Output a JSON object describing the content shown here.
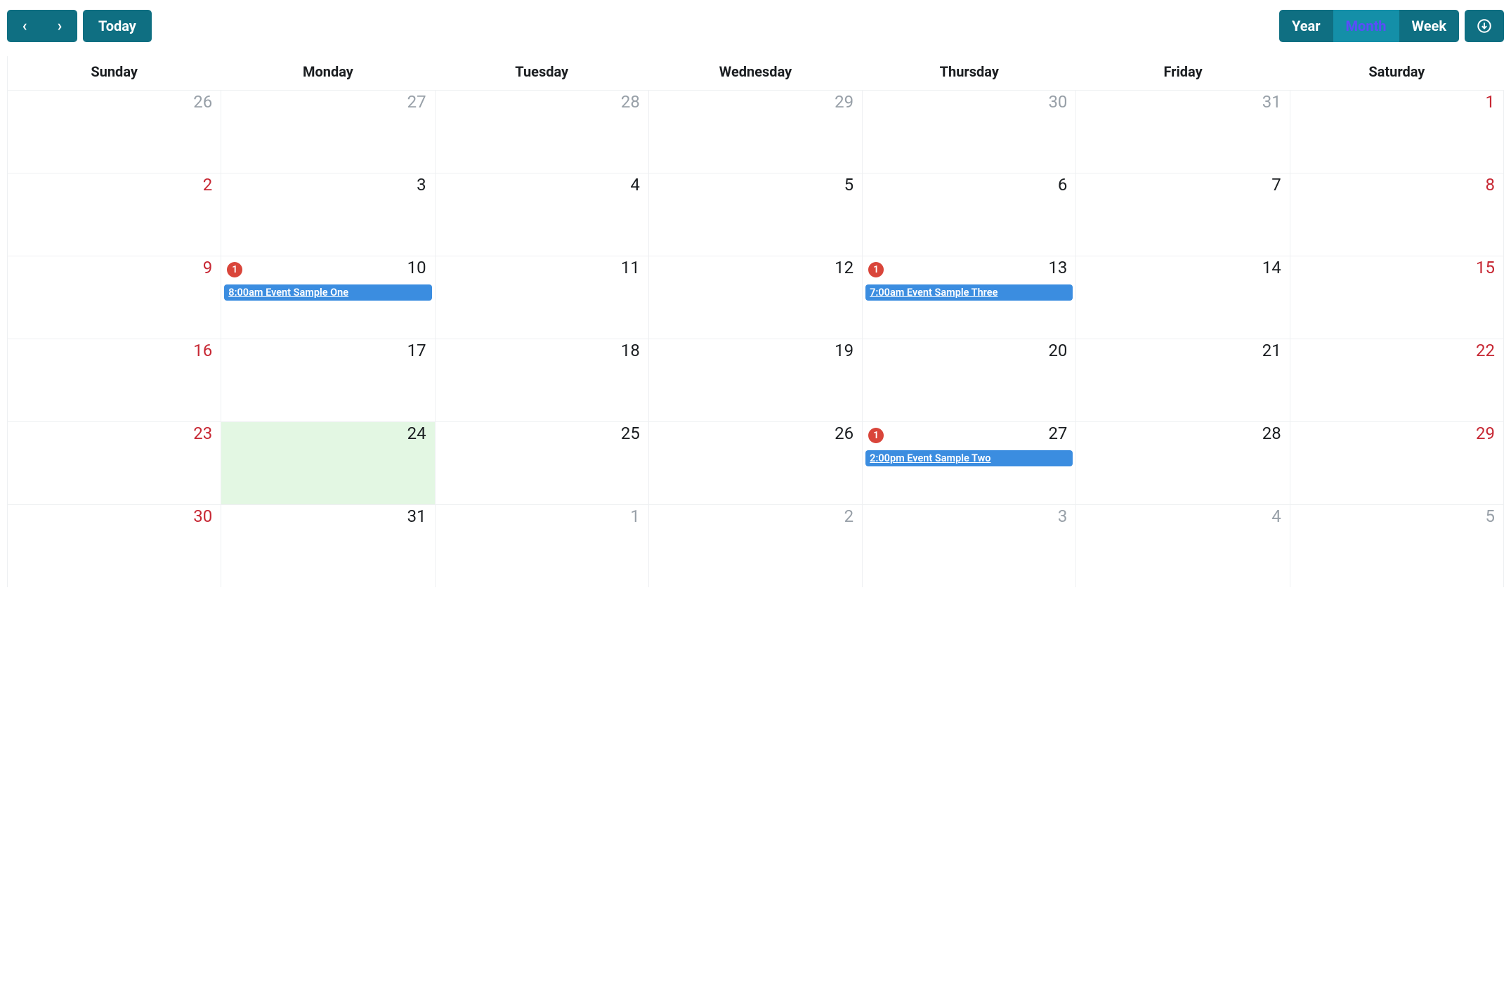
{
  "toolbar": {
    "prev_label": "‹",
    "next_label": "›",
    "today_label": "Today",
    "views": {
      "year": "Year",
      "month": "Month",
      "week": "Week"
    },
    "active_view": "month",
    "download_icon_name": "download-circle-icon"
  },
  "calendar": {
    "day_headers": [
      "Sunday",
      "Monday",
      "Tuesday",
      "Wednesday",
      "Thursday",
      "Friday",
      "Saturday"
    ],
    "weeks": [
      {
        "days": [
          {
            "num": "26",
            "other": true
          },
          {
            "num": "27",
            "other": true
          },
          {
            "num": "28",
            "other": true
          },
          {
            "num": "29",
            "other": true
          },
          {
            "num": "30",
            "other": true
          },
          {
            "num": "31",
            "other": true
          },
          {
            "num": "1",
            "weekend": true
          }
        ]
      },
      {
        "days": [
          {
            "num": "2",
            "weekend": true
          },
          {
            "num": "3"
          },
          {
            "num": "4"
          },
          {
            "num": "5"
          },
          {
            "num": "6"
          },
          {
            "num": "7"
          },
          {
            "num": "8",
            "weekend": true
          }
        ]
      },
      {
        "days": [
          {
            "num": "9",
            "weekend": true
          },
          {
            "num": "10",
            "badge": "1",
            "event": "8:00am Event Sample One"
          },
          {
            "num": "11"
          },
          {
            "num": "12"
          },
          {
            "num": "13",
            "badge": "1",
            "event": "7:00am Event Sample Three"
          },
          {
            "num": "14"
          },
          {
            "num": "15",
            "weekend": true
          }
        ]
      },
      {
        "days": [
          {
            "num": "16",
            "weekend": true
          },
          {
            "num": "17"
          },
          {
            "num": "18"
          },
          {
            "num": "19"
          },
          {
            "num": "20"
          },
          {
            "num": "21"
          },
          {
            "num": "22",
            "weekend": true
          }
        ]
      },
      {
        "days": [
          {
            "num": "23",
            "weekend": true
          },
          {
            "num": "24",
            "today": true
          },
          {
            "num": "25"
          },
          {
            "num": "26"
          },
          {
            "num": "27",
            "badge": "1",
            "event": "2:00pm Event Sample Two"
          },
          {
            "num": "28"
          },
          {
            "num": "29",
            "weekend": true
          }
        ]
      },
      {
        "days": [
          {
            "num": "30",
            "weekend": true
          },
          {
            "num": "31"
          },
          {
            "num": "1",
            "other": true
          },
          {
            "num": "2",
            "other": true
          },
          {
            "num": "3",
            "other": true
          },
          {
            "num": "4",
            "other": true
          },
          {
            "num": "5",
            "other": true
          }
        ]
      }
    ]
  }
}
